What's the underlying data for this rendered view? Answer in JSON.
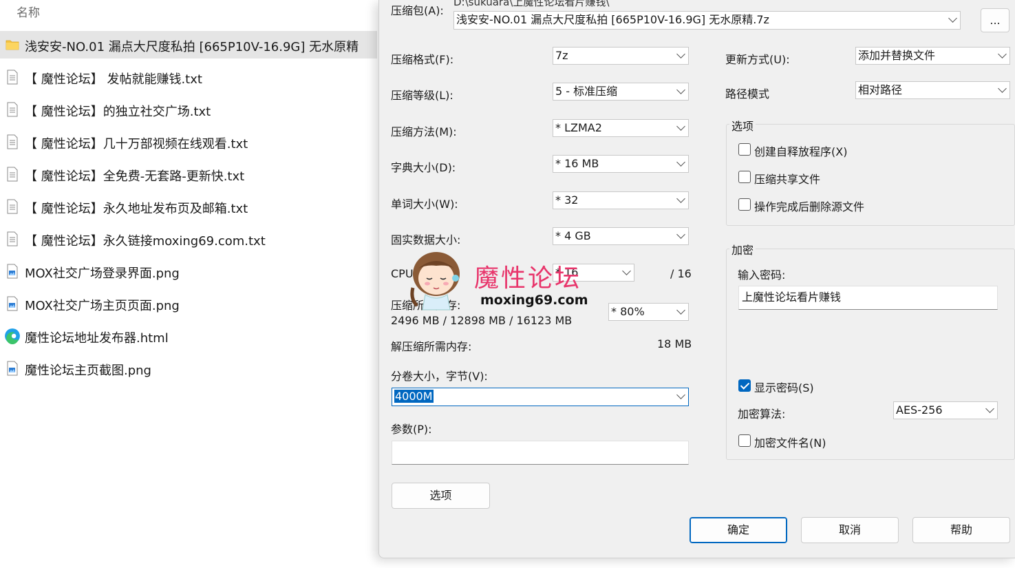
{
  "explorer": {
    "column_header": "名称",
    "files": [
      {
        "name": "浅安安-NO.01 漏点大尺度私拍 [665P10V-16.9G] 无水原精",
        "icon": "folder-icon",
        "selected": true
      },
      {
        "name": "【 魔性论坛】 发帖就能赚钱.txt",
        "icon": "text-file-icon"
      },
      {
        "name": "【 魔性论坛】的独立社交广场.txt",
        "icon": "text-file-icon"
      },
      {
        "name": "【 魔性论坛】几十万部视频在线观看.txt",
        "icon": "text-file-icon"
      },
      {
        "name": "【 魔性论坛】全免费-无套路-更新快.txt",
        "icon": "text-file-icon"
      },
      {
        "name": "【 魔性论坛】永久地址发布页及邮箱.txt",
        "icon": "text-file-icon"
      },
      {
        "name": "【 魔性论坛】永久链接moxing69.com.txt",
        "icon": "text-file-icon"
      },
      {
        "name": "MOX社交广场登录界面.png",
        "icon": "image-file-icon"
      },
      {
        "name": "MOX社交广场主页页面.png",
        "icon": "image-file-icon"
      },
      {
        "name": "魔性论坛地址发布器.html",
        "icon": "edge-browser-icon"
      },
      {
        "name": "魔性论坛主页截图.png",
        "icon": "image-file-icon"
      }
    ]
  },
  "dialog": {
    "archive_label": "压缩包(A):",
    "archive_path_partial": "D:\\sukuara\\上魔性论坛看片赚钱\\",
    "archive_name": "浅安安-NO.01 漏点大尺度私拍 [665P10V-16.9G] 无水原精.7z",
    "browse_label": "...",
    "format_label": "压缩格式(F):",
    "format_value": "7z",
    "level_label": "压缩等级(L):",
    "level_value": "5 - 标准压缩",
    "method_label": "压缩方法(M):",
    "method_value": "*  LZMA2",
    "dict_label": "字典大小(D):",
    "dict_value": "*  16 MB",
    "word_label": "单词大小(W):",
    "word_value": "*  32",
    "solid_label": "固实数据大小:",
    "solid_value": "*  4 GB",
    "cpu_label": "CPU",
    "cpu_value": "*  16",
    "cpu_total": "/ 16",
    "mem_label": "压缩所需内存:",
    "mem_detail": "2496 MB / 12898 MB / 16123 MB",
    "mem_value": "*  80%",
    "decomp_label": "解压缩所需内存:",
    "decomp_value": "18 MB",
    "volume_label": "分卷大小，字节(V):",
    "volume_value": "4000M",
    "params_label": "参数(P):",
    "params_value": "",
    "options_button": "选项",
    "update_label": "更新方式(U):",
    "update_value": "添加并替换文件",
    "path_label": "路径模式",
    "path_value": "相对路径",
    "options_group": "选项",
    "opt_sfx": "创建自释放程序(X)",
    "opt_shared": "压缩共享文件",
    "opt_delete": "操作完成后删除源文件",
    "encrypt_group": "加密",
    "password_label": "输入密码:",
    "password_value": "上魔性论坛看片赚钱",
    "show_password": "显示密码(S)",
    "enc_method_label": "加密算法:",
    "enc_method_value": "AES-256",
    "enc_names": "加密文件名(N)",
    "ok_button": "确定",
    "cancel_button": "取消",
    "help_button": "帮助"
  },
  "watermark": {
    "title": "魔性论坛",
    "url": "moxing69.com"
  },
  "colors": {
    "accent": "#0067c0",
    "selection_bg": "#e5e5e5",
    "watermark_pink": "#e8356b"
  }
}
